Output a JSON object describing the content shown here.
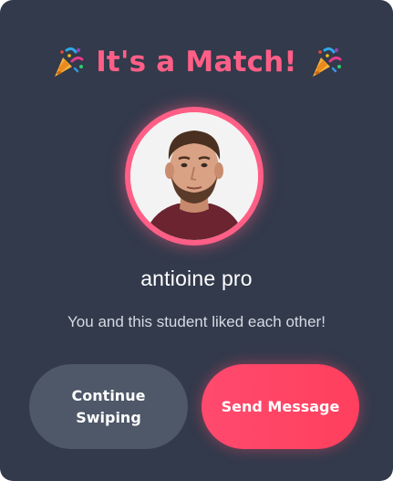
{
  "modal": {
    "title": "It's a Match!",
    "title_icon": "party-popper-icon",
    "match_name": "antioine pro",
    "message": "You and this student liked each other!"
  },
  "buttons": {
    "continue_label": "Continue Swiping",
    "send_label": "Send Message"
  },
  "colors": {
    "background": "#323a4b",
    "accent": "#ff5f87",
    "continue_button": "#4f5868",
    "send_button": "#ff4a6e",
    "text": "#ffffff",
    "muted_text": "#d6dae3"
  }
}
